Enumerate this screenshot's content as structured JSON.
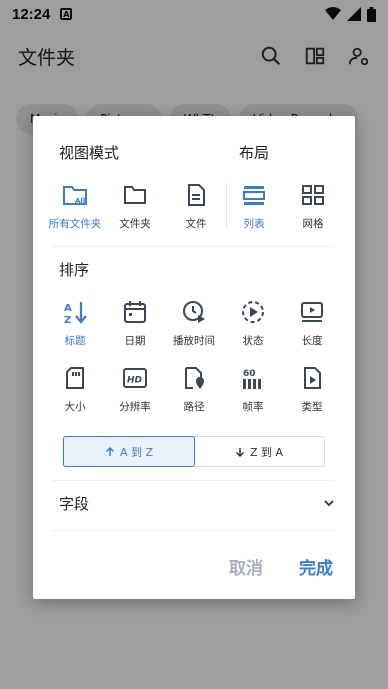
{
  "statusbar": {
    "time": "12:24",
    "notif": "A"
  },
  "appbar": {
    "title": "文件夹"
  },
  "chips": [
    "Music",
    "Pictures",
    "WhTL",
    "Video Recorder"
  ],
  "dialog": {
    "view_mode_title": "视图模式",
    "layout_title": "布局",
    "view_modes": [
      {
        "label": "所有文件夹",
        "icon": "all-folders-icon"
      },
      {
        "label": "文件夹",
        "icon": "folder-icon"
      },
      {
        "label": "文件",
        "icon": "file-icon"
      }
    ],
    "layouts": [
      {
        "label": "列表",
        "icon": "list-icon"
      },
      {
        "label": "网格",
        "icon": "grid-icon"
      }
    ],
    "sort_title": "排序",
    "sort_items": [
      {
        "label": "标题",
        "icon": "sort-az-icon"
      },
      {
        "label": "日期",
        "icon": "calendar-icon"
      },
      {
        "label": "播放时间",
        "icon": "clock-play-icon"
      },
      {
        "label": "状态",
        "icon": "status-icon"
      },
      {
        "label": "长度",
        "icon": "length-icon"
      },
      {
        "label": "大小",
        "icon": "sd-card-icon"
      },
      {
        "label": "分辨率",
        "icon": "hd-icon"
      },
      {
        "label": "路径",
        "icon": "file-location-icon"
      },
      {
        "label": "帧率",
        "icon": "framerate-icon"
      },
      {
        "label": "类型",
        "icon": "file-type-icon"
      }
    ],
    "order": {
      "asc": "A 到 Z",
      "desc": "Z 到 A"
    },
    "field_label": "字段",
    "cancel": "取消",
    "done": "完成"
  },
  "colors": {
    "accent": "#3a7bd5",
    "icon": "#3c4757",
    "disabled": "#a9b0bb"
  }
}
